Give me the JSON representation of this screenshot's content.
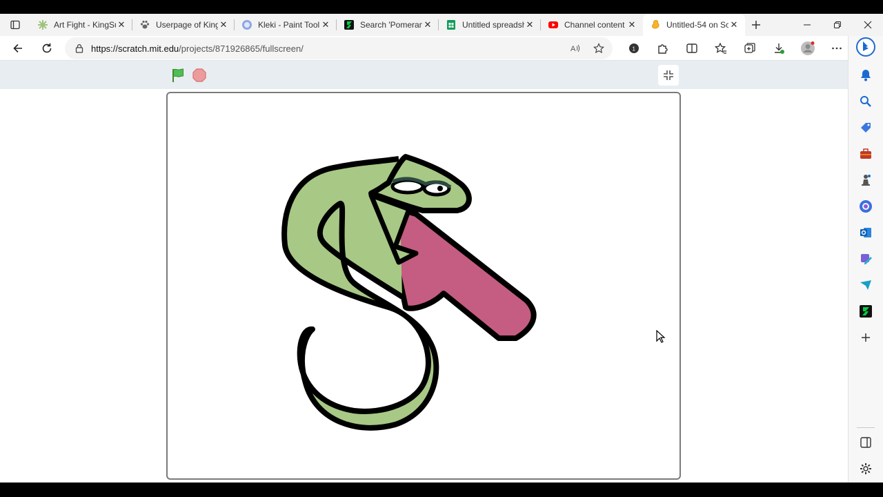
{
  "browser": {
    "tabs": [
      {
        "title": "Art Fight - KingSu",
        "icon": "sparkle-icon",
        "color": "#7bb661"
      },
      {
        "title": "Userpage of King",
        "icon": "paw-icon",
        "color": "#666666"
      },
      {
        "title": "Kleki - Paint Tool",
        "icon": "kleki-icon",
        "color": "#6f8fdc"
      },
      {
        "title": "Search 'Pomerani",
        "icon": "deviantart-icon",
        "color": "#05cc47"
      },
      {
        "title": "Untitled spreadsh",
        "icon": "sheets-icon",
        "color": "#0f9d58"
      },
      {
        "title": "Channel content",
        "icon": "youtube-icon",
        "color": "#ff0000"
      },
      {
        "title": "Untitled-54 on Sc",
        "icon": "scratch-icon",
        "color": "#f7b32b",
        "active": true
      }
    ],
    "address": {
      "host": "https://scratch.mit.edu",
      "path": "/projects/871926865/fullscreen/"
    }
  },
  "scratch": {
    "controls": [
      "green-flag",
      "stop"
    ],
    "colors": {
      "bar": "#e8edf1",
      "snake_green": "#a8c886",
      "letter_pink": "#c55c82",
      "outline": "#000000"
    }
  }
}
